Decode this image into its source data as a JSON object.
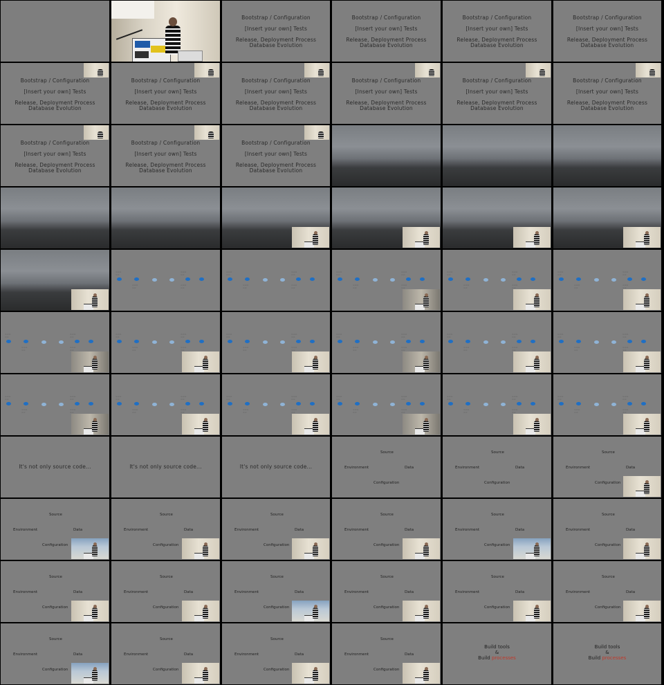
{
  "slides": {
    "bootstrap": "Bootstrap / Configuration",
    "tests": "[Insert your own] Tests",
    "release": "Release, Deployment Process",
    "database": "Database Evolution",
    "not_only": "It's not only source code...",
    "source": "Source",
    "environment": "Environment",
    "data": "Data",
    "configuration": "Configuration",
    "build_tools": "Build tools",
    "amp": "&",
    "build": "Build",
    "processes": "processes"
  },
  "colors": {
    "slide_bg": "#7f7f7f",
    "dot_dark": "#1f6fc4",
    "dot_light": "#8fb3d6",
    "accent_red": "#c0392b"
  }
}
